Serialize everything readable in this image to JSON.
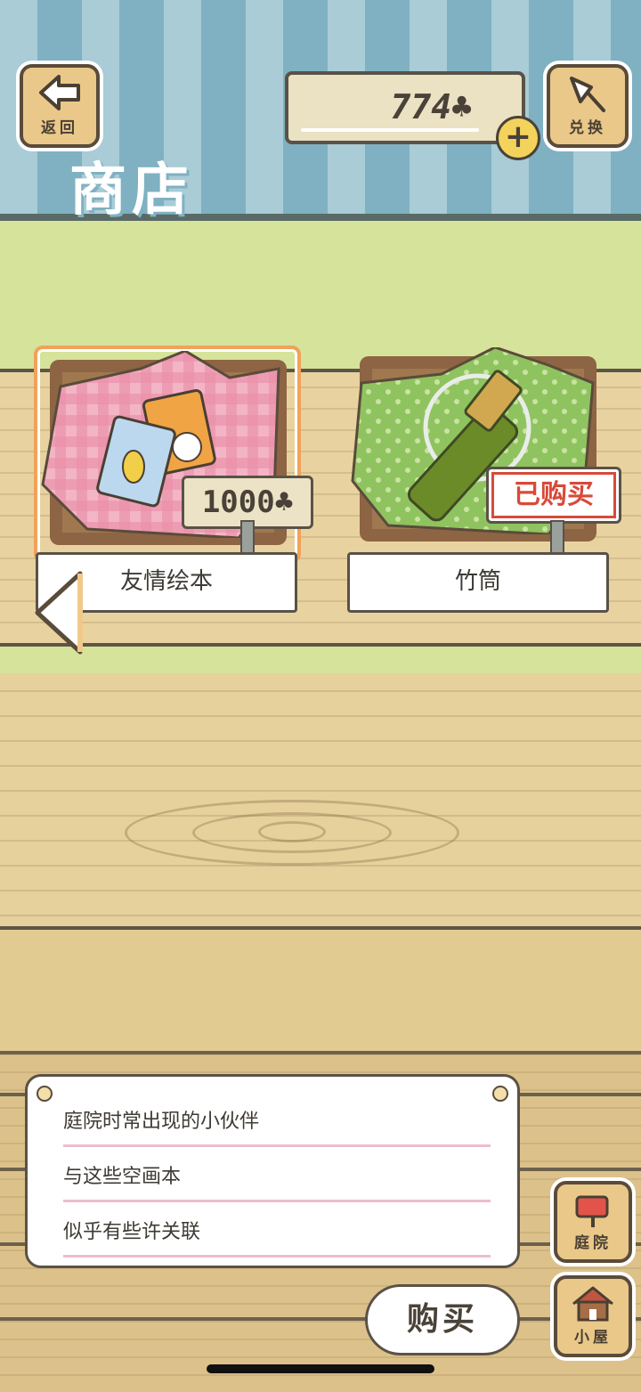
{
  "header": {
    "back_label": "返回",
    "exchange_label": "兑换",
    "title": "商店",
    "coins": "774",
    "coin_symbol": "♣",
    "add_label": "+"
  },
  "items": [
    {
      "name": "友情绘本",
      "price": "1000",
      "status": "for-sale",
      "selected": true
    },
    {
      "name": "竹筒",
      "status_label": "已购买",
      "status": "purchased",
      "selected": false
    }
  ],
  "nav": {
    "prev_label": "◀"
  },
  "description": {
    "lines": [
      "庭院时常出现的小伙伴",
      "与这些空画本",
      "似乎有些许关联"
    ]
  },
  "actions": {
    "buy_label": "购买"
  },
  "side_nav": {
    "yard_label": "庭院",
    "house_label": "小屋"
  },
  "colors": {
    "accent_orange": "#f0a25a",
    "purchased_red": "#d84a3a",
    "wall_blue": "#7fb1c2"
  }
}
